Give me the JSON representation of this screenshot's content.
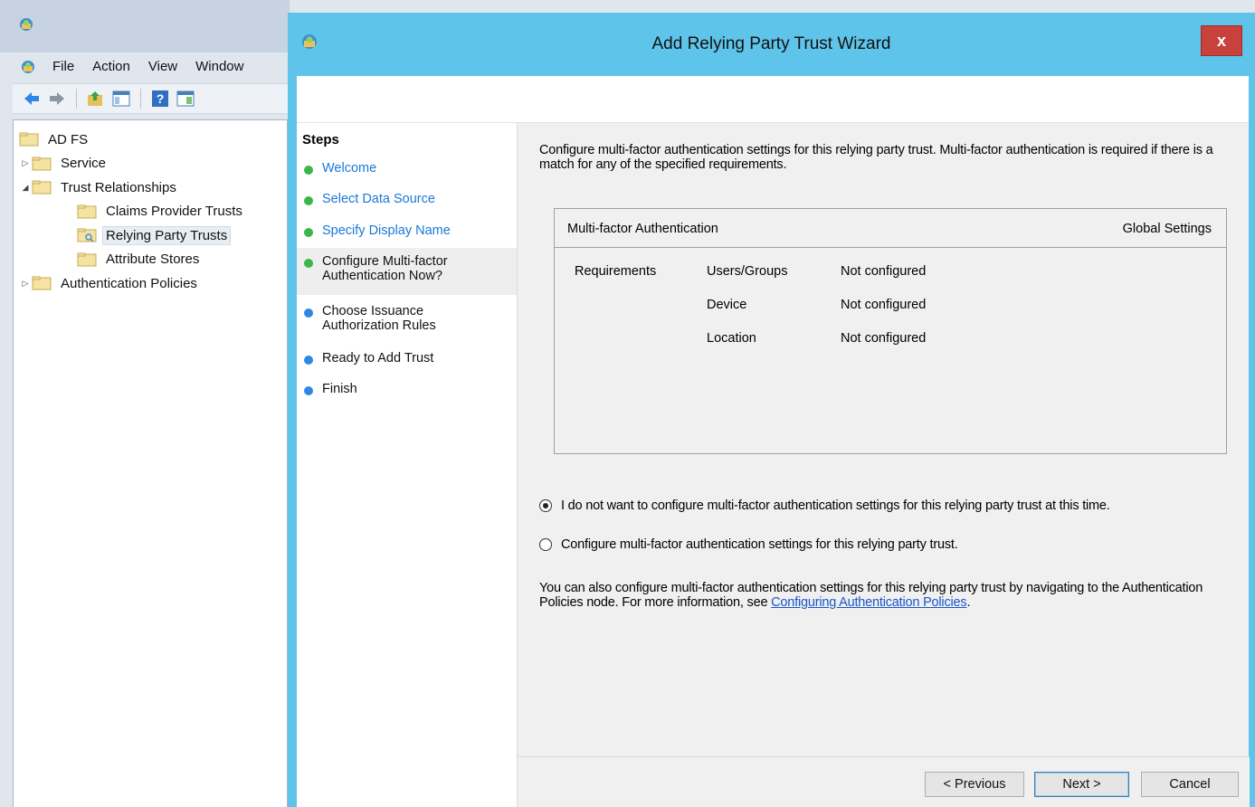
{
  "mmc": {
    "menu": [
      "File",
      "Action",
      "View",
      "Window"
    ],
    "tree": [
      {
        "label": "AD FS",
        "expander": "",
        "indent": 0
      },
      {
        "label": "Service",
        "expander": "▷",
        "indent": 1
      },
      {
        "label": "Trust Relationships",
        "expander": "◢",
        "indent": 1
      },
      {
        "label": "Claims Provider Trusts",
        "expander": "",
        "indent": 2
      },
      {
        "label": "Relying Party Trusts",
        "expander": "",
        "indent": 2,
        "selected": true
      },
      {
        "label": "Attribute Stores",
        "expander": "",
        "indent": 2
      },
      {
        "label": "Authentication Policies",
        "expander": "▷",
        "indent": 1
      }
    ]
  },
  "wizard": {
    "title": "Add Relying Party Trust Wizard",
    "close_label": "x",
    "steps_title": "Steps",
    "steps": [
      {
        "label": "Welcome",
        "state": "done"
      },
      {
        "label": "Select Data Source",
        "state": "done"
      },
      {
        "label": "Specify Display Name",
        "state": "done"
      },
      {
        "label": "Configure Multi-factor Authentication Now?",
        "state": "current"
      },
      {
        "label": "Choose Issuance Authorization Rules",
        "state": "future"
      },
      {
        "label": "Ready to Add Trust",
        "state": "future"
      },
      {
        "label": "Finish",
        "state": "future"
      }
    ],
    "intro": "Configure multi-factor authentication settings for this relying party trust. Multi-factor authentication is required if there is a match for any of the specified requirements.",
    "mfa": {
      "header_left": "Multi-factor Authentication",
      "header_right": "Global Settings",
      "requirements_label": "Requirements",
      "rows": [
        {
          "name": "Users/Groups",
          "value": "Not configured"
        },
        {
          "name": "Device",
          "value": "Not configured"
        },
        {
          "name": "Location",
          "value": "Not configured"
        }
      ]
    },
    "options": [
      {
        "label": "I do not want to configure multi-factor authentication settings for this relying party trust at this time.",
        "checked": true
      },
      {
        "label": "Configure multi-factor authentication settings for this relying party trust.",
        "checked": false
      }
    ],
    "info_text": "You can also configure multi-factor authentication settings for this relying party trust by navigating to the Authentication Policies node. For more information, see ",
    "info_link": "Configuring Authentication Policies",
    "info_end": ".",
    "buttons": {
      "previous": "< Previous",
      "next": "Next >",
      "cancel": "Cancel"
    }
  },
  "colors": {
    "wizard_chrome": "#5fc4ea",
    "close_button": "#c9413d",
    "step_done_dot": "#3cb54a",
    "step_future_dot": "#2f86e6",
    "link": "#1a56c8"
  }
}
